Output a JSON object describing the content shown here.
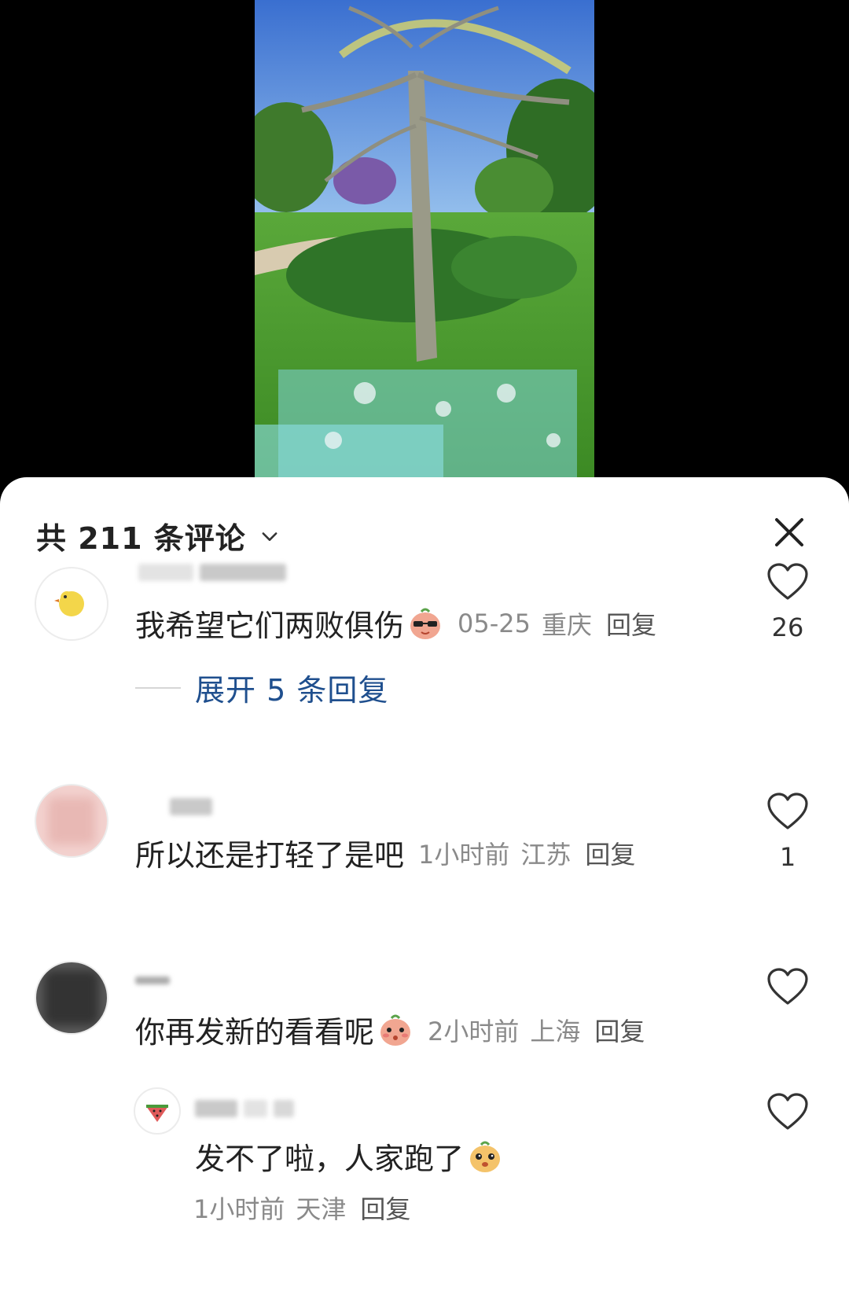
{
  "header": {
    "title": "共 211 条评论"
  },
  "comments": [
    {
      "text": "我希望它们两败俱伤",
      "emoji": "sunglasses-emoji",
      "date": "05-25",
      "location": "重庆",
      "reply": "回复",
      "likes": "26",
      "expand_replies": "展开 5 条回复"
    },
    {
      "text": "所以还是打轻了是吧",
      "date": "1小时前",
      "location": "江苏",
      "reply": "回复",
      "likes": "1"
    },
    {
      "text": "你再发新的看看呢",
      "emoji": "shy-emoji",
      "date": "2小时前",
      "location": "上海",
      "reply": "回复",
      "likes": ""
    }
  ],
  "sub_comment": {
    "text": "发不了啦，人家跑了",
    "emoji": "cute-emoji",
    "date": "1小时前",
    "location": "天津",
    "reply": "回复",
    "likes": ""
  },
  "colors": {
    "link": "#1f4f8e",
    "meta": "#8a8a8a",
    "text": "#222222"
  }
}
